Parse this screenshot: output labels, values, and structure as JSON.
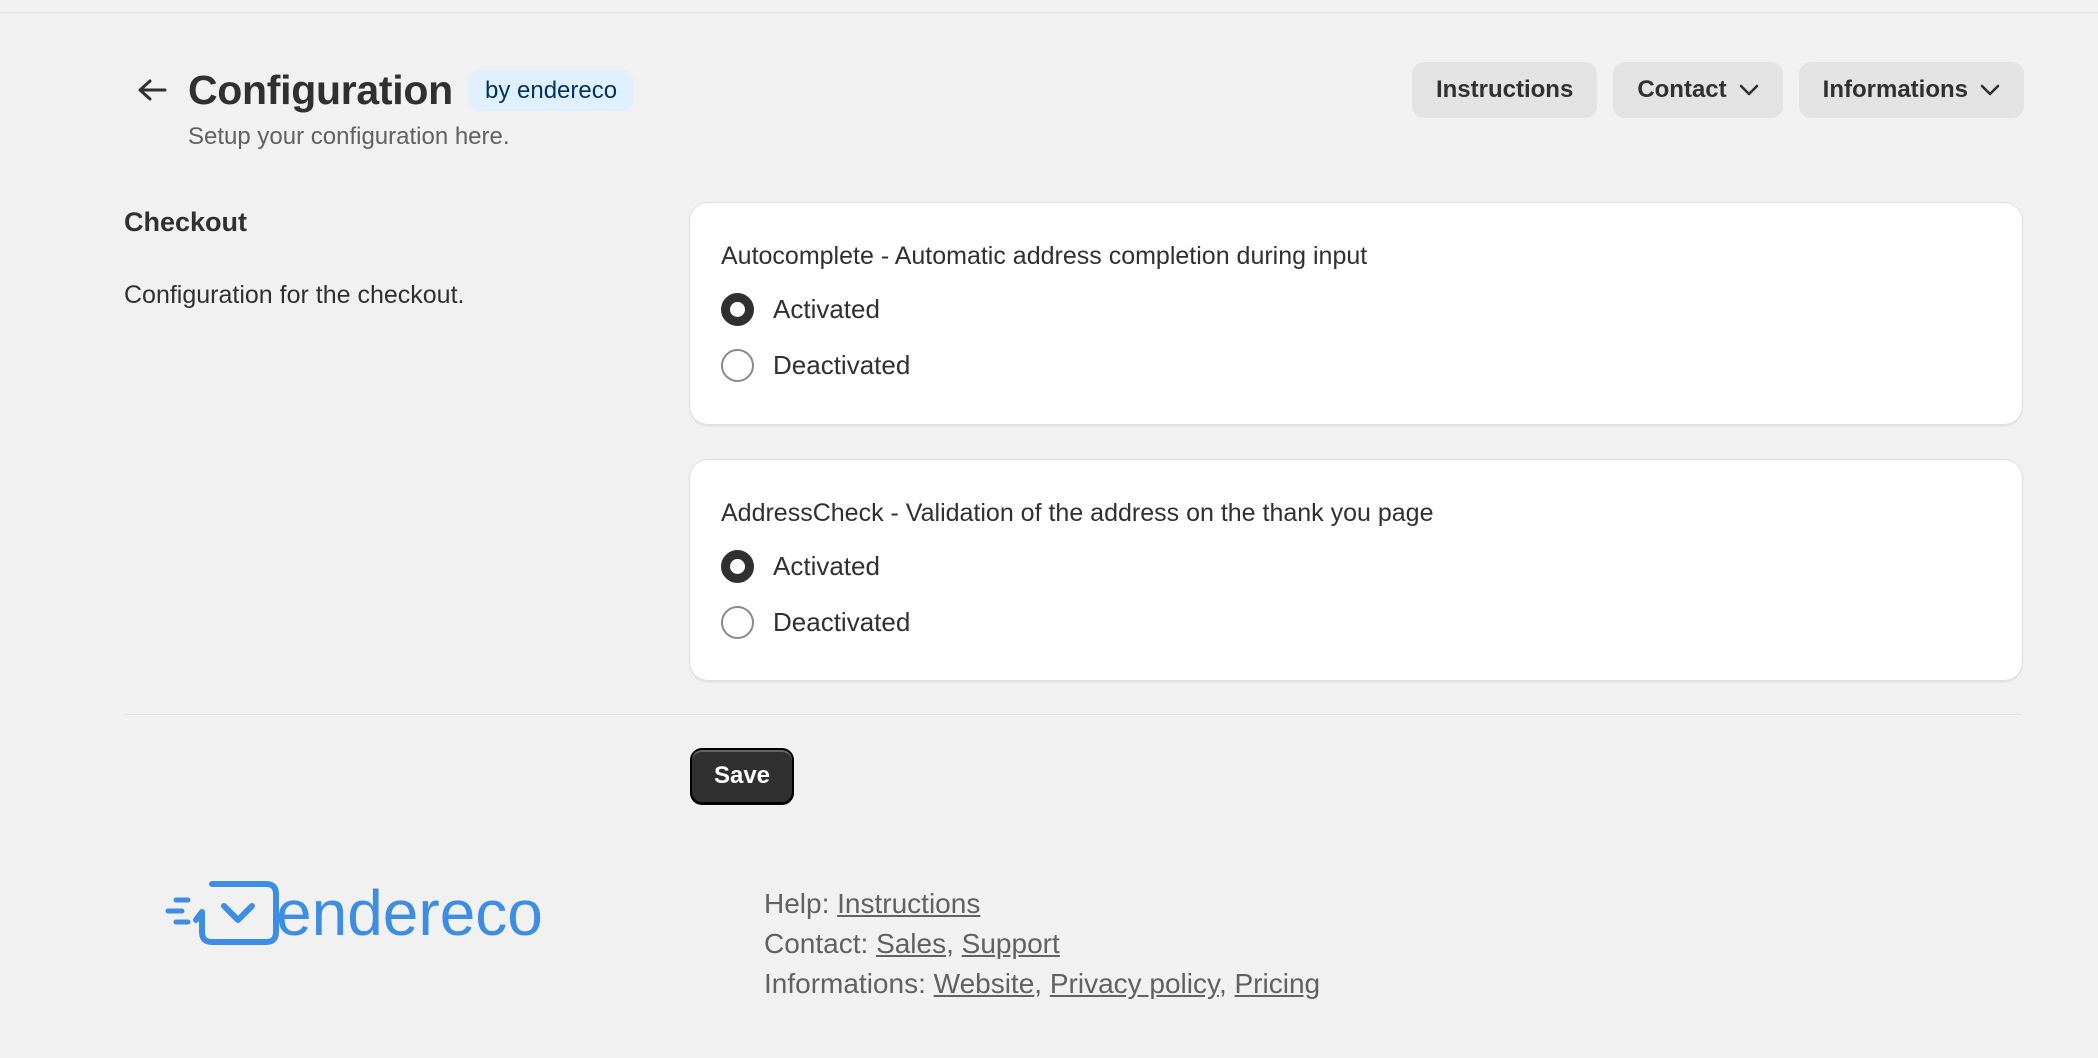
{
  "header": {
    "title": "Configuration",
    "badge": "by endereco",
    "subtitle": "Setup your configuration here.",
    "actions": {
      "instructions_label": "Instructions",
      "contact_label": "Contact",
      "informations_label": "Informations"
    },
    "icons": {
      "back": "arrow-left-icon",
      "dropdown": "chevron-down-icon"
    }
  },
  "section": {
    "title": "Checkout",
    "description": "Configuration for the checkout."
  },
  "settings": [
    {
      "title": "Autocomplete - Automatic address completion during input",
      "options": [
        "Activated",
        "Deactivated"
      ],
      "selected": "Activated"
    },
    {
      "title": "AddressCheck - Validation of the address on the thank you page",
      "options": [
        "Activated",
        "Deactivated"
      ],
      "selected": "Activated"
    }
  ],
  "save_label": "Save",
  "footer": {
    "logo_text": "endereco",
    "logo_color": "#3d8de2",
    "help_prefix": "Help:",
    "help_instructions": "Instructions",
    "contact_prefix": "Contact:",
    "contact_sales": "Sales",
    "contact_support": "Support",
    "info_prefix": "Informations:",
    "info_website": "Website",
    "info_privacy": "Privacy policy",
    "info_pricing": "Pricing",
    "separator": ","
  }
}
